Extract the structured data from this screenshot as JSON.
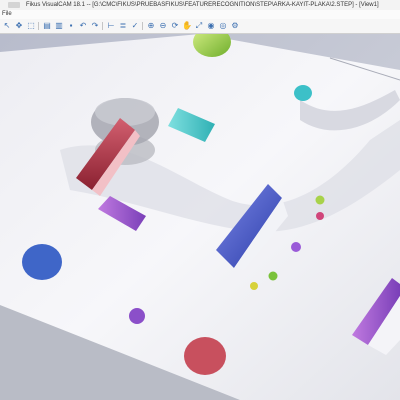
{
  "window": {
    "title": "Fikus VisualCAM 18.1 -- [G:\\CMC\\FIKUS\\PRUEBASFIKUS\\FEATURERECOGNITION\\STEP\\ARKA-KAYIT-PLAKA\\2.STEP] - [View1]"
  },
  "menu": {
    "items": [
      "File"
    ]
  },
  "toolbar": {
    "buttons": [
      {
        "icon": "pointer-icon",
        "glyph": "↖"
      },
      {
        "icon": "move-icon",
        "glyph": "✥"
      },
      {
        "icon": "select-icon",
        "glyph": "⬚"
      },
      {
        "icon": "new-icon",
        "glyph": "▤"
      },
      {
        "icon": "open-icon",
        "glyph": "▥"
      },
      {
        "icon": "save-icon",
        "glyph": "▪"
      },
      {
        "icon": "undo-icon",
        "glyph": "↶"
      },
      {
        "icon": "redo-icon",
        "glyph": "↷"
      },
      {
        "icon": "measure-icon",
        "glyph": "⊢"
      },
      {
        "icon": "list-icon",
        "glyph": "≣"
      },
      {
        "icon": "check-icon",
        "glyph": "✓"
      },
      {
        "icon": "zoom-in-icon",
        "glyph": "⊕"
      },
      {
        "icon": "zoom-out-icon",
        "glyph": "⊖"
      },
      {
        "icon": "rotate-icon",
        "glyph": "⟳"
      },
      {
        "icon": "pan-icon",
        "glyph": "✋"
      },
      {
        "icon": "fit-view-icon",
        "glyph": "⤢"
      },
      {
        "icon": "shaded-icon",
        "glyph": "◉"
      },
      {
        "icon": "wireframe-icon",
        "glyph": "◎"
      },
      {
        "icon": "feature-icon",
        "glyph": "⚙"
      }
    ]
  },
  "colors": {
    "background": "#c9cbd6",
    "plate": "#e9eaf0",
    "accent_blue": "#3b6fb0"
  }
}
